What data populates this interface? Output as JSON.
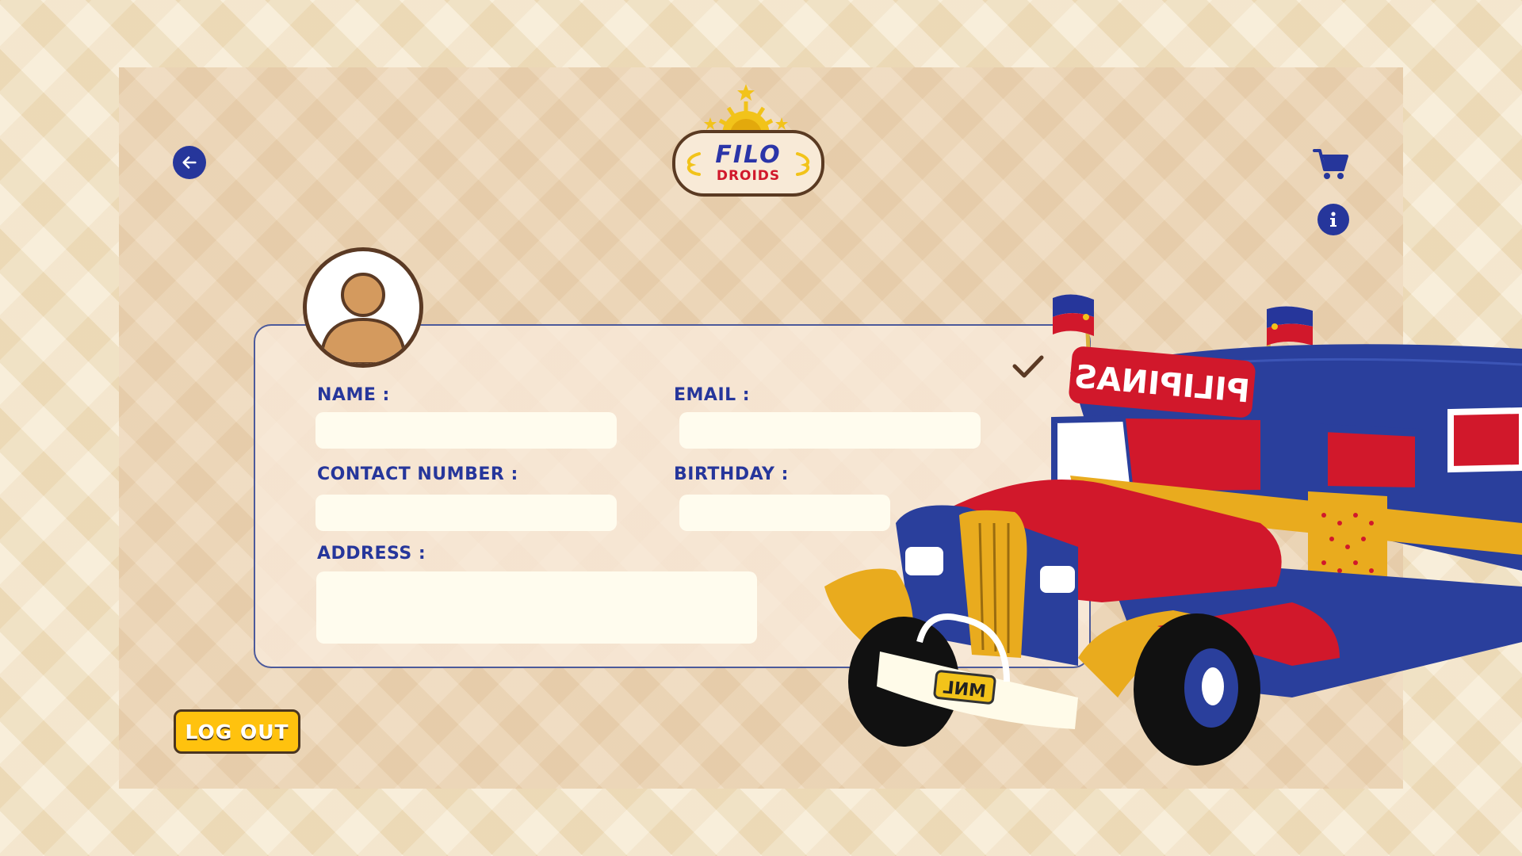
{
  "brand": {
    "logo_top": "FILO",
    "logo_bottom": "DROIDS"
  },
  "icons": {
    "back": "arrow-left-icon",
    "cart": "shopping-cart-icon",
    "info": "info-icon",
    "confirm": "check-icon",
    "avatar": "user-avatar-icon"
  },
  "form": {
    "name_label": "NAME :",
    "name_value": "",
    "email_label": "EMAIL :",
    "email_value": "",
    "contact_label": "CONTACT NUMBER :",
    "contact_value": "",
    "birthday_label": "BIRTHDAY :",
    "birthday_value": "",
    "address_label": "ADDRESS :",
    "address_value": ""
  },
  "actions": {
    "logout_label": "LOG OUT"
  },
  "illustration": {
    "jeepney_sign": "PILIPINAS",
    "plate": "MNL"
  },
  "colors": {
    "primary_blue": "#26369b",
    "accent_yellow": "#ffc20e",
    "accent_red": "#d1182b",
    "brown": "#5b3a24",
    "field_bg": "#fffcee"
  }
}
